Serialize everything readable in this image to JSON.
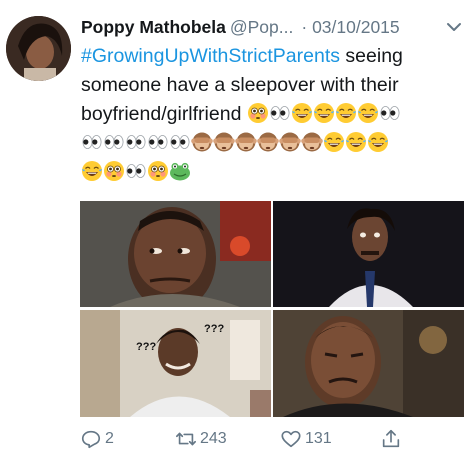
{
  "tweet": {
    "author_name": "Poppy Mathobela",
    "handle": "@Pop...",
    "date": "· 03/10/2015",
    "hashtag": "#GrowingUpWithStrictParents",
    "text_line1_rest": " seeing",
    "text_line2": "someone have a sleepover with their",
    "text_line3": "boyfriend/girlfriend"
  },
  "emojis": {
    "line3": [
      "flushed-face",
      "eyes",
      "joy-face",
      "joy-face",
      "joy-face",
      "joy-face",
      "eyes"
    ],
    "line4": [
      "eyes",
      "eyes",
      "eyes",
      "eyes",
      "eyes",
      "see-no-evil-monkey",
      "see-no-evil-monkey",
      "see-no-evil-monkey",
      "see-no-evil-monkey",
      "see-no-evil-monkey",
      "see-no-evil-monkey",
      "joy-face",
      "joy-face",
      "joy-face"
    ],
    "line5": [
      "joy-face",
      "flushed-face",
      "eyes",
      "flushed-face",
      "frog-face"
    ]
  },
  "photos": [
    "reaction-photo-side-eye",
    "reaction-photo-stunned-man",
    "reaction-photo-confused-question-marks",
    "reaction-photo-squinting-man"
  ],
  "photo_overlay_text": {
    "question_marks_left": "???",
    "question_marks_right": "???"
  },
  "actions": {
    "reply_count": "2",
    "retweet_count": "243",
    "like_count": "131"
  },
  "colors": {
    "hashtag": "#1b95e0",
    "secondary_text": "#657786",
    "primary_text": "#14171a"
  }
}
